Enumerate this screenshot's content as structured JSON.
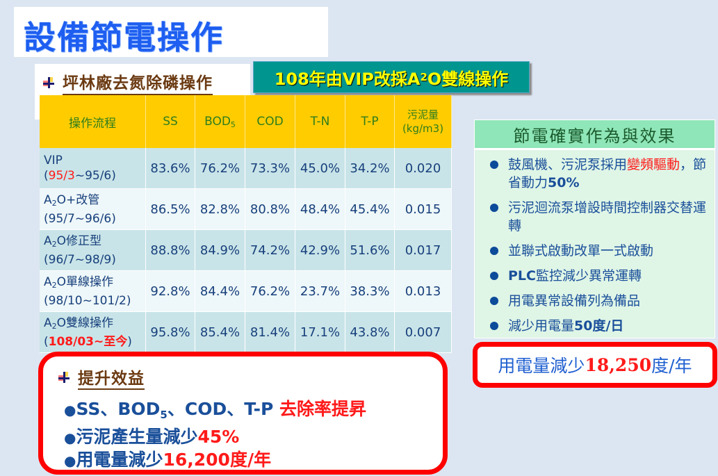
{
  "title": "設備節電操作",
  "section": {
    "label": "坪林廠去氮除磷操作",
    "banner_pre": "108年由VIP改採A",
    "banner_sub": "2",
    "banner_post": "O雙線操作"
  },
  "table": {
    "headers": {
      "process": "操作流程",
      "ss": "SS",
      "bod": "BOD",
      "bod_sub": "5",
      "cod": "COD",
      "tn": "T-N",
      "tp": "T-P",
      "sludge_line1": "污泥量",
      "sludge_line2": "(kg/m3)"
    },
    "rows": [
      {
        "name_pre": "VIP",
        "name_sub": "",
        "name_post": "",
        "period_open": "(",
        "period_red": "95/3",
        "period_rest": "~95/6)",
        "ss": "83.6%",
        "bod": "76.2%",
        "cod": "73.3%",
        "tn": "45.0%",
        "tp": "34.2%",
        "sludge": "0.020"
      },
      {
        "name_pre": "A",
        "name_sub": "2",
        "name_post": "O+改管",
        "period_open": "",
        "period_red": "",
        "period_rest": "(95/7~96/6)",
        "ss": "86.5%",
        "bod": "82.8%",
        "cod": "80.8%",
        "tn": "48.4%",
        "tp": "45.4%",
        "sludge": "0.015"
      },
      {
        "name_pre": "A",
        "name_sub": "2",
        "name_post": "O修正型",
        "period_open": "",
        "period_red": "",
        "period_rest": "(96/7~98/9)",
        "ss": "88.8%",
        "bod": "84.9%",
        "cod": "74.2%",
        "tn": "42.9%",
        "tp": "51.6%",
        "sludge": "0.017"
      },
      {
        "name_pre": "A",
        "name_sub": "2",
        "name_post": "O單線操作",
        "period_open": "",
        "period_red": "",
        "period_rest": "(98/10~101/2)",
        "ss": "92.8%",
        "bod": "84.4%",
        "cod": "76.2%",
        "tn": "23.7%",
        "tp": "38.3%",
        "sludge": "0.013"
      },
      {
        "name_pre": "A",
        "name_sub": "2",
        "name_post": "O雙線操作",
        "period_open": "(",
        "period_red": "108/03~至今",
        "period_rest": ")",
        "ss": "95.8%",
        "bod": "85.4%",
        "cod": "81.4%",
        "tn": "17.1%",
        "tp": "43.8%",
        "sludge": "0.007"
      }
    ]
  },
  "benefit": {
    "label": "提升效益",
    "line1_pre": "SS、BOD",
    "line1_sub": "5",
    "line1_mid": "、COD、T-P ",
    "line1_hl": "去除率提昇",
    "line2_pre": "污泥產生量減少",
    "line2_hl": "45%",
    "line3_pre": "用電量減少",
    "line3_hl": "16,200度/年",
    "bullet": "●"
  },
  "right_panel": {
    "title": "節電確實作為與效果",
    "items": [
      {
        "pre": "鼓風機、污泥泵採用",
        "hl": "變頻驅動",
        "post": "，節省動力",
        "bold": "50%"
      },
      {
        "pre": "污泥迴流泵增設時間控制器交替運轉",
        "hl": "",
        "post": "",
        "bold": ""
      },
      {
        "pre": "並聯式啟動改單一式啟動",
        "hl": "",
        "post": "",
        "bold": ""
      },
      {
        "pre": "",
        "hl": "",
        "post": "監控減少異常運轉",
        "bold": "PLC",
        "bold_first": true
      },
      {
        "pre": "用電異常設備列為備品",
        "hl": "",
        "post": "",
        "bold": ""
      },
      {
        "pre": "減少用電量",
        "hl": "",
        "post": "",
        "bold": "50度/日"
      }
    ]
  },
  "savings": {
    "pre": "用電量減少",
    "num": "18,250",
    "post": "度/年"
  },
  "colors": {
    "background": "#dce6f2",
    "title_blue": "#1e5ef0",
    "header_yellow": "#ffcc00",
    "banner_teal": "#00968f",
    "highlight_red": "#ff1a1a",
    "border_red": "#ff0000",
    "text_blue": "#1a4f9a"
  }
}
